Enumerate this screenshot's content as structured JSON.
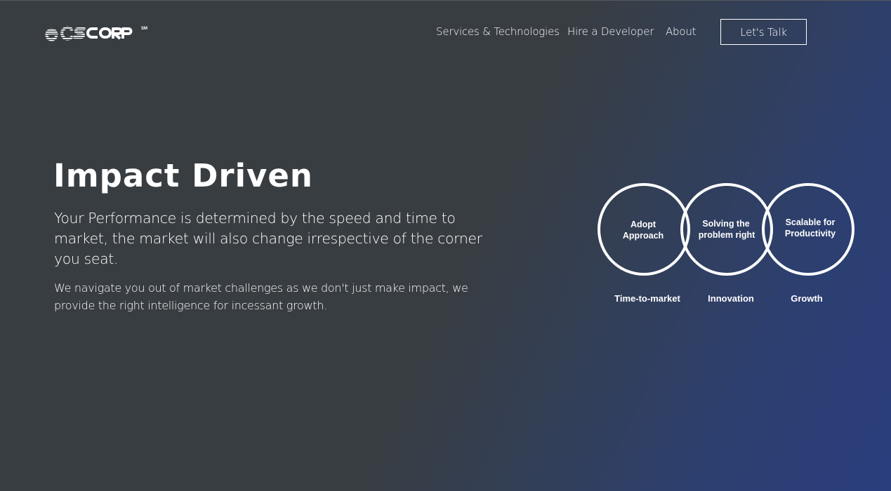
{
  "brand": {
    "logo_text": "ecscorp",
    "logo_mark": "SM",
    "colors": {
      "text": "#ffffff",
      "background_dark": "#383d42",
      "background_blue": "#2a3e7e"
    }
  },
  "nav": {
    "items": [
      {
        "label": "Services & Technologies"
      },
      {
        "label": "Hire a Developer"
      },
      {
        "label": "About"
      }
    ],
    "cta_label": "Let's Talk"
  },
  "hero": {
    "title": "Impact Driven",
    "lead": "Your Performance is determined by the speed and time to market, the market will also change irrespective of the corner you seat.",
    "sub": "We navigate you out of market challenges as we don't just make impact, we provide the right intelligence for incessant growth."
  },
  "diagram": {
    "circles": [
      {
        "line1": "Adopt",
        "line2": "Approach",
        "caption": "Time-to-market"
      },
      {
        "line1": "Solving the",
        "line2": "problem right",
        "caption": "Innovation"
      },
      {
        "line1": "Scalable for",
        "line2": "Productivity",
        "caption": "Growth"
      }
    ]
  }
}
